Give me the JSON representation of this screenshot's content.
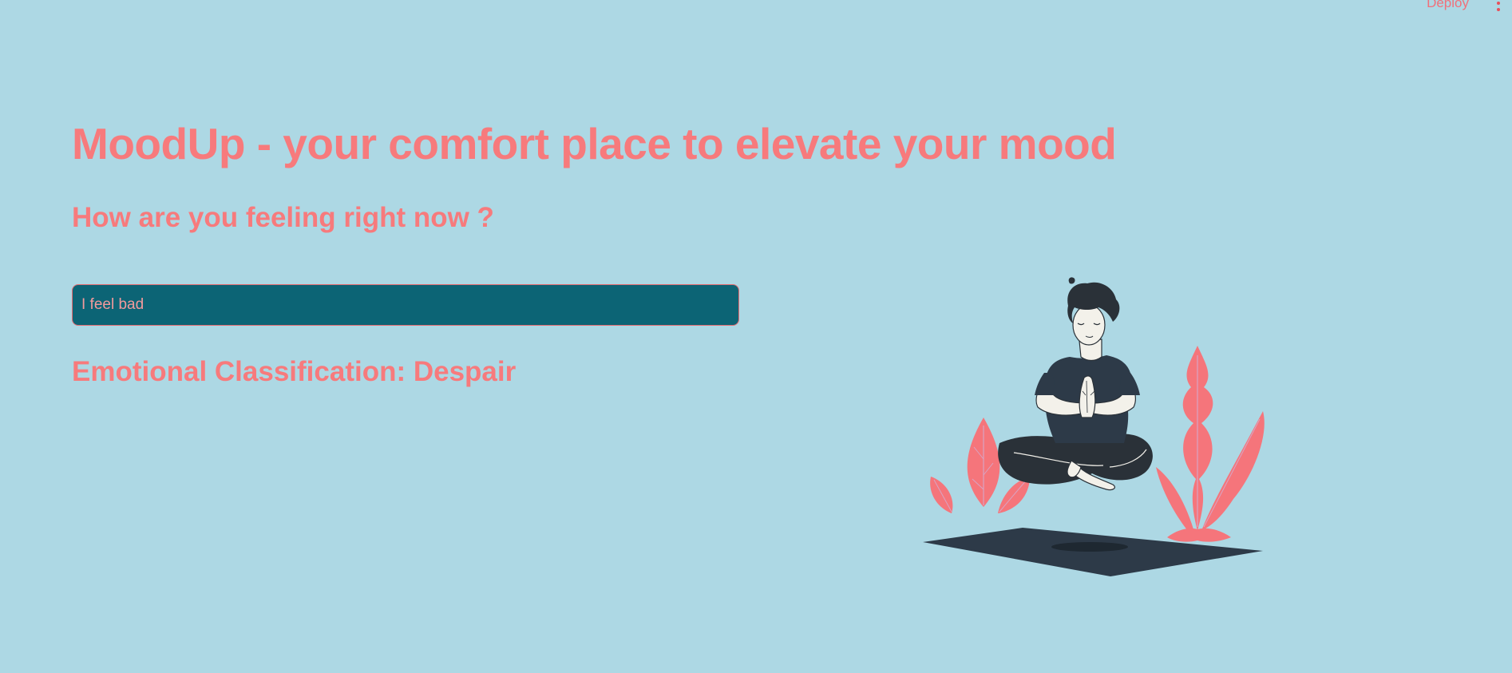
{
  "toolbar": {
    "deploy_label": "Deploy",
    "menu_icon": "vertical-dots-icon"
  },
  "header": {
    "title": "MoodUp - your comfort place to elevate your mood",
    "subtitle": "How are you feeling right now ?"
  },
  "input": {
    "value": "I feel bad",
    "placeholder": ""
  },
  "result": {
    "label": "Emotional Classification: Despair"
  },
  "illustration": {
    "name": "meditating-person-illustration"
  },
  "colors": {
    "background": "#add8e4",
    "accent": "#f77a7c",
    "input_background": "#0c6475",
    "figure_dark": "#2d3a48"
  }
}
